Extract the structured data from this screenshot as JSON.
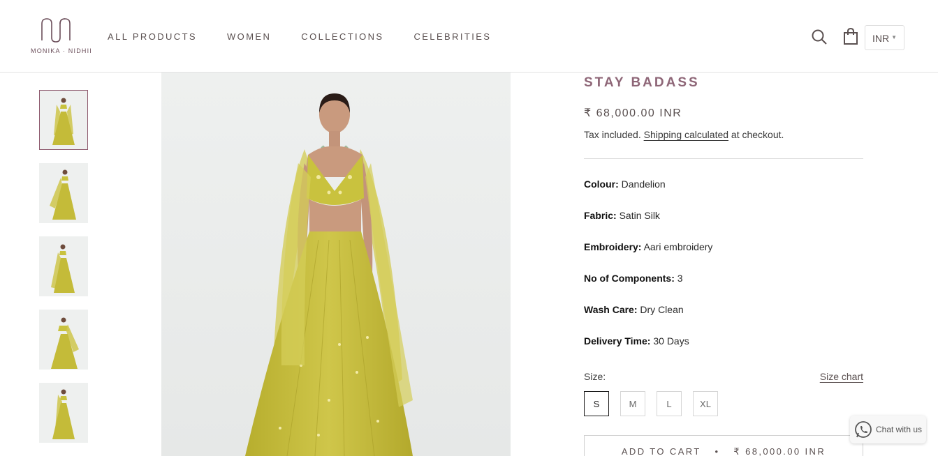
{
  "brand": {
    "name": "MONIKA · NIDHII"
  },
  "nav": [
    {
      "label": "ALL PRODUCTS"
    },
    {
      "label": "WOMEN"
    },
    {
      "label": "COLLECTIONS"
    },
    {
      "label": "CELEBRITIES"
    }
  ],
  "header": {
    "currency": "INR",
    "icons": [
      "search-icon",
      "shopping-bag-icon",
      "chevron-down-icon"
    ]
  },
  "gallery": {
    "thumbnail_count": 5,
    "active_thumbnail": 1
  },
  "product": {
    "title": "STAY BADASS",
    "price": "₹ 68,000.00 INR",
    "tax_prefix": "Tax included.",
    "shipping_link": "Shipping calculated",
    "tax_suffix": "at checkout.",
    "specs": [
      {
        "label": "Colour:",
        "value": "Dandelion"
      },
      {
        "label": "Fabric:",
        "value": "Satin Silk"
      },
      {
        "label": "Embroidery:",
        "value": "Aari embroidery"
      },
      {
        "label": "No of Components:",
        "value": "3"
      },
      {
        "label": "Wash Care:",
        "value": "Dry Clean"
      },
      {
        "label": "Delivery Time:",
        "value": "30 Days"
      }
    ],
    "size_label": "Size:",
    "size_chart_link": "Size chart",
    "sizes": [
      "S",
      "M",
      "L",
      "XL"
    ],
    "selected_size": "S",
    "add_to_cart_label": "ADD TO CART",
    "add_to_cart_separator": "•",
    "add_to_cart_price": "₹ 68,000.00 INR"
  },
  "chat": {
    "label": "Chat with us",
    "icon": "whatsapp-icon"
  },
  "colors": {
    "accent_title": "#8e6677",
    "garment": "#c9c23e",
    "active_border": "#8e5a6e"
  }
}
